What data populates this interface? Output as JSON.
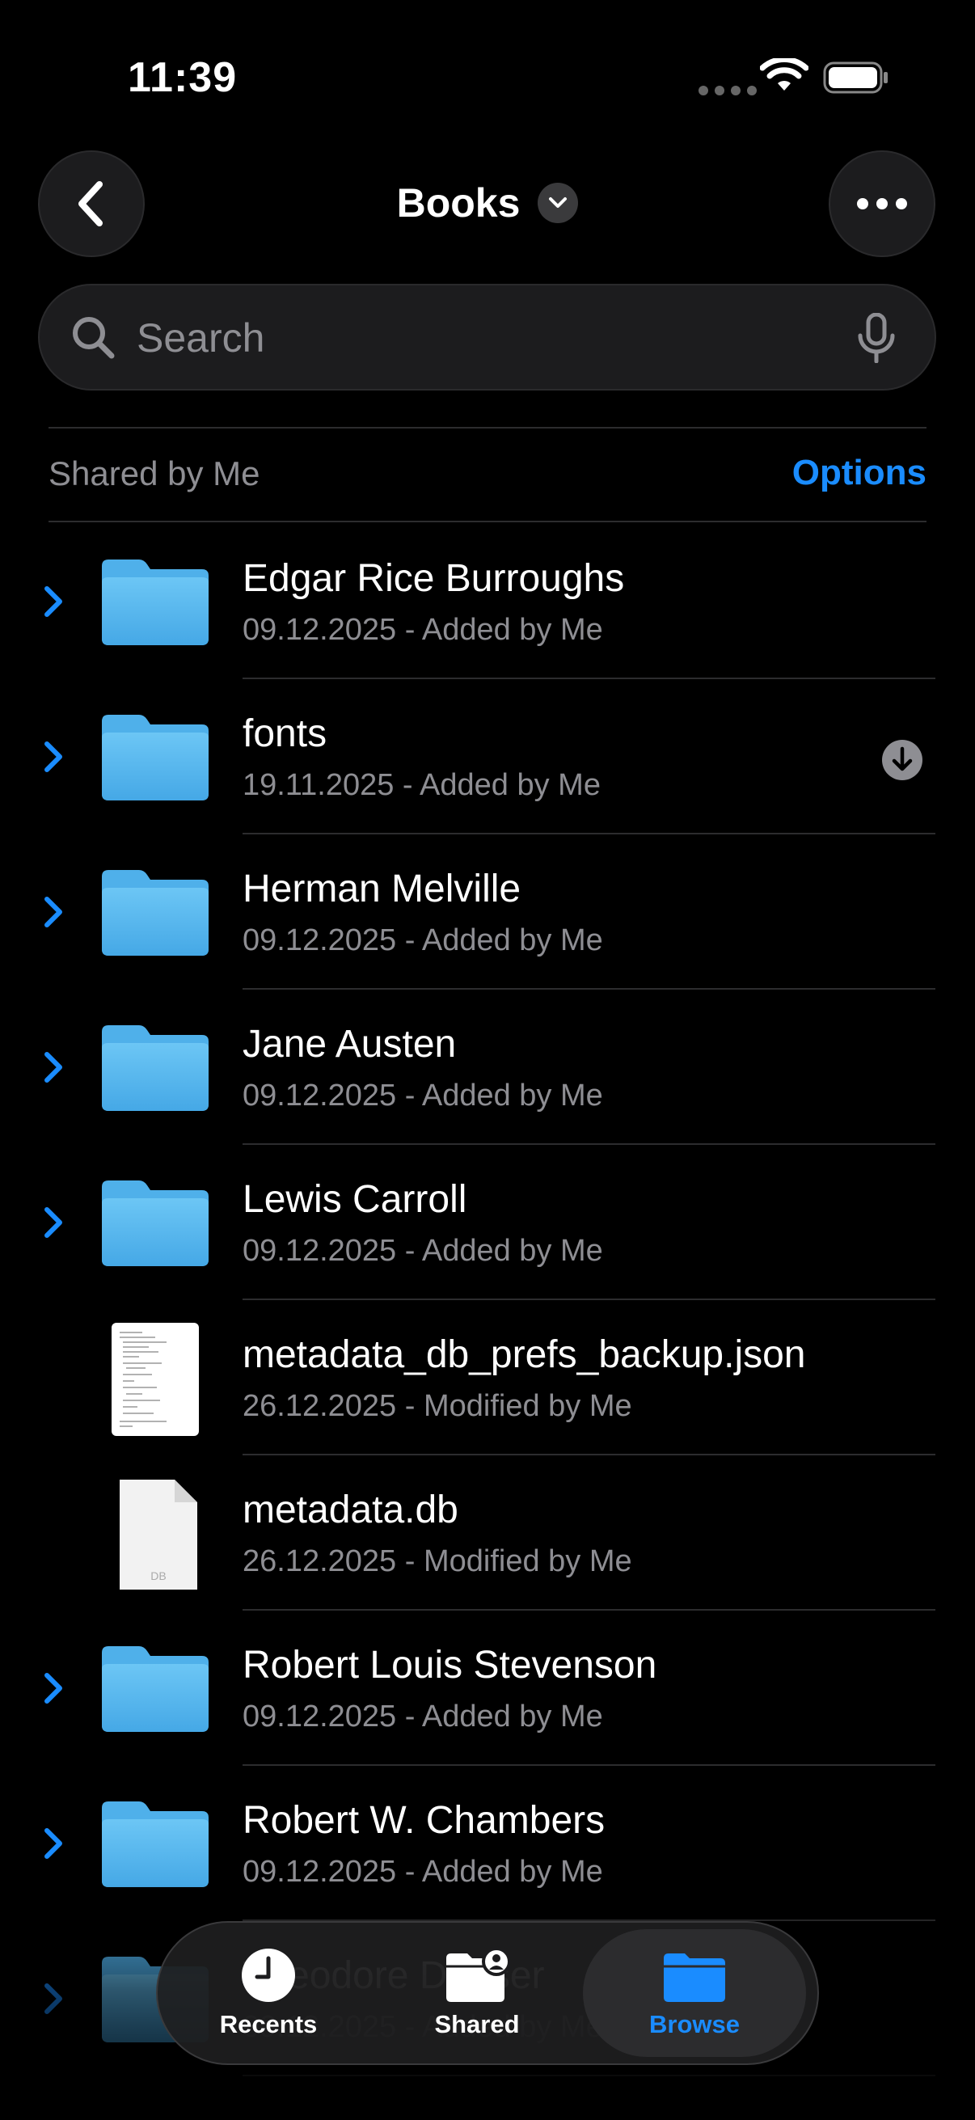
{
  "status_bar": {
    "time": "11:39"
  },
  "nav": {
    "title": "Books"
  },
  "search": {
    "placeholder": "Search"
  },
  "section": {
    "title": "Shared by Me",
    "options_label": "Options"
  },
  "files": [
    {
      "name": "Edgar Rice Burroughs",
      "meta": "09.12.2025 - Added by Me",
      "kind": "folder"
    },
    {
      "name": "fonts",
      "meta": "19.11.2025 - Added by Me",
      "kind": "folder",
      "download": true
    },
    {
      "name": "Herman Melville",
      "meta": "09.12.2025 - Added by Me",
      "kind": "folder"
    },
    {
      "name": "Jane Austen",
      "meta": "09.12.2025 - Added by Me",
      "kind": "folder"
    },
    {
      "name": "Lewis Carroll",
      "meta": "09.12.2025 - Added by Me",
      "kind": "folder"
    },
    {
      "name": "metadata_db_prefs_backup.json",
      "meta": "26.12.2025 - Modified by Me",
      "kind": "json-document"
    },
    {
      "name": "metadata.db",
      "meta": "26.12.2025 - Modified by Me",
      "kind": "db-document",
      "icon_label": "DB"
    },
    {
      "name": "Robert Louis Stevenson",
      "meta": "09.12.2025 - Added by Me",
      "kind": "folder"
    },
    {
      "name": "Robert W. Chambers",
      "meta": "09.12.2025 - Added by Me",
      "kind": "folder"
    },
    {
      "name": "Theodore Dreiser",
      "meta": "09.12.2025 - Added by Me",
      "kind": "folder"
    }
  ],
  "tab_bar": {
    "tabs": [
      {
        "label": "Recents",
        "icon": "clock-icon",
        "selected": false
      },
      {
        "label": "Shared",
        "icon": "shared-folder-icon",
        "selected": false
      },
      {
        "label": "Browse",
        "icon": "folder-icon",
        "selected": true
      }
    ]
  },
  "colors": {
    "accent": "#1a8cff",
    "folder": "#5ab8f0",
    "secondary_text": "#8e8e93",
    "background": "#000000"
  }
}
